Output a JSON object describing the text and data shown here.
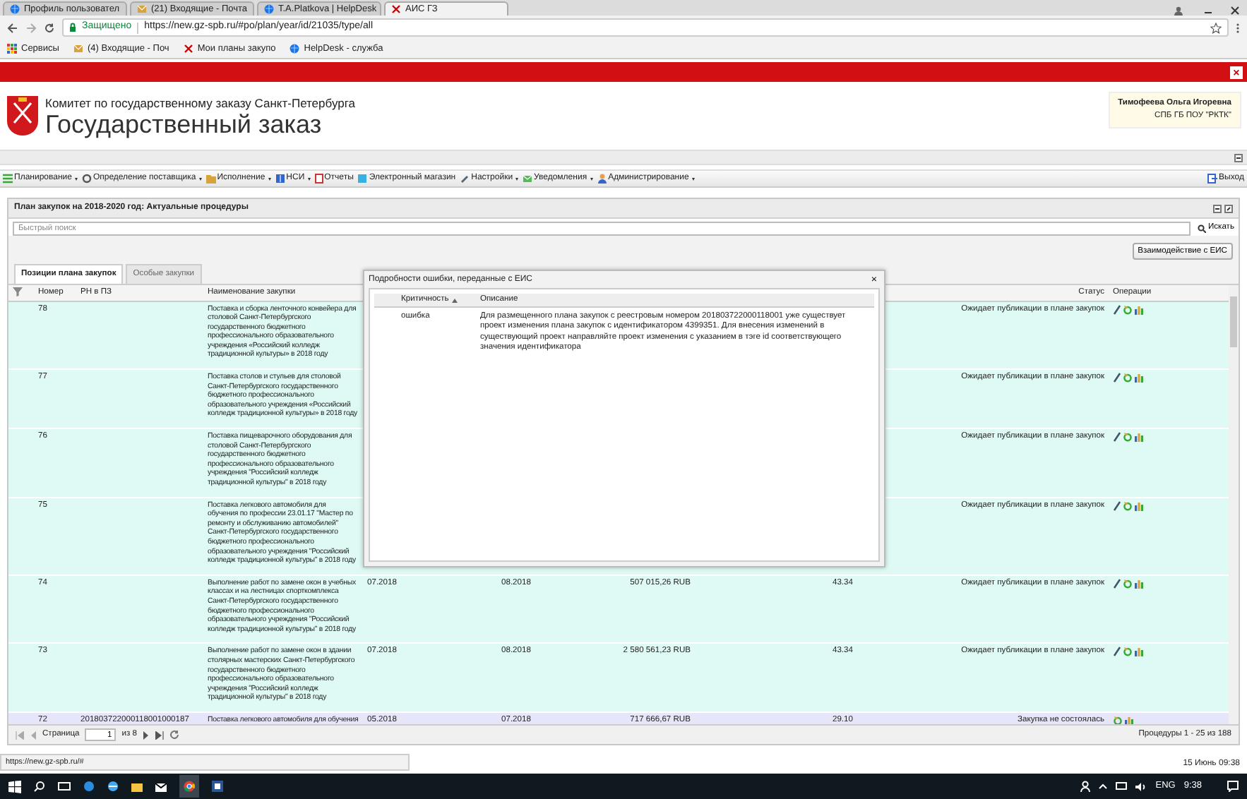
{
  "browser": {
    "tabs": [
      {
        "label": "Профиль пользовател",
        "selected": false
      },
      {
        "label": "(21) Входящие - Почта",
        "selected": false
      },
      {
        "label": "T.A.Platkova | HelpDesk",
        "selected": false
      },
      {
        "label": "АИС ГЗ",
        "selected": true
      }
    ],
    "address": {
      "secure_label": "Защищено",
      "url": "https://new.gz-spb.ru/#po/plan/year/id/21035/type/all"
    },
    "bookmarks": [
      "Сервисы",
      "(4) Входящие - Поч",
      "Мои планы закупо",
      "HelpDesk - служба"
    ]
  },
  "alert_bar": {
    "close": "×"
  },
  "header": {
    "org": "Комитет по государственному заказу Санкт-Петербурга",
    "title": "Государственный заказ",
    "user": {
      "name": "Тимофеева Ольга Игоревна",
      "org": "СПБ ГБ ПОУ \"РКТК\""
    }
  },
  "menu": [
    {
      "label": "Планирование",
      "dropdown": true
    },
    {
      "label": "Определение поставщика",
      "dropdown": true
    },
    {
      "label": "Исполнение",
      "dropdown": true
    },
    {
      "label": "НСИ",
      "dropdown": true
    },
    {
      "label": "Отчеты",
      "dropdown": false
    },
    {
      "label": "Электронный магазин",
      "dropdown": false
    },
    {
      "label": "Настройки",
      "dropdown": true
    },
    {
      "label": "Уведомления",
      "dropdown": true
    },
    {
      "label": "Администрирование",
      "dropdown": true
    }
  ],
  "exit": "Выход",
  "panel": {
    "title": "План закупок на 2018-2020 год: Актуальные процедуры",
    "search": {
      "placeholder": "Быстрый поиск",
      "button": "Искать"
    },
    "eis_button": "Взаимодействие с ЕИС",
    "tabs": [
      {
        "label": "Позиции плана закупок",
        "selected": true
      },
      {
        "label": "Особые закупки",
        "selected": false
      }
    ],
    "table": {
      "columns": [
        "Номер",
        "РН в ПЗ",
        "Наименование закупки",
        "Статус",
        "Операции"
      ],
      "rows": [
        {
          "number": "78",
          "name": "Поставка и сборка ленточного конвейера для столовой Санкт-Петербургского государственного бюджетного профессионального образовательного учреждения «Российский колледж традиционной культуры» в 2018 году",
          "status": "Ожидает публикации в плане закупок",
          "selected": false,
          "actions": [
            {
              "kind": "edit"
            },
            {
              "kind": "refresh"
            },
            {
              "kind": "chart"
            }
          ]
        },
        {
          "number": "77",
          "name": "Поставка столов и стульев для столовой Санкт-Петербургского государственного бюджетного профессионального образовательного учреждения «Российский колледж традиционной культуры» в 2018 году",
          "status": "Ожидает публикации в плане закупок",
          "selected": false,
          "actions": [
            {
              "kind": "edit"
            },
            {
              "kind": "refresh"
            },
            {
              "kind": "chart"
            }
          ]
        },
        {
          "number": "76",
          "name": "Поставка пищеварочного оборудования для столовой Санкт-Петербургского государственного бюджетного профессионального образовательного учреждения \"Российский колледж традиционной культуры\" в 2018 году",
          "status": "Ожидает публикации в плане закупок",
          "selected": false,
          "actions": [
            {
              "kind": "edit"
            },
            {
              "kind": "refresh"
            },
            {
              "kind": "chart"
            }
          ]
        },
        {
          "number": "75",
          "name": "Поставка легкового автомобиля для обучения по профессии 23.01.17 \"Мастер по ремонту и обслуживанию автомобилей\" Санкт-Петербургского государственного бюджетного профессионального образовательного учреждения \"Российский колледж традиционной культуры\" в 2018 году",
          "status": "Ожидает публикации в плане закупок",
          "selected": false,
          "actions": [
            {
              "kind": "edit"
            },
            {
              "kind": "refresh"
            },
            {
              "kind": "chart"
            }
          ]
        },
        {
          "number": "74",
          "name": "Выполнение работ по замене окон в учебных классах и на лестницах спорткомплекса Санкт-Петербургского государственного бюджетного профессионального образовательного учреждения \"Российский колледж традиционной культуры\" в 2018 году",
          "start": "07.2018",
          "end": "08.2018",
          "amount": "507 015,26 RUB",
          "value": "43.34",
          "status": "Ожидает публикации в плане закупок",
          "selected": false,
          "actions": [
            {
              "kind": "edit"
            },
            {
              "kind": "refresh"
            },
            {
              "kind": "chart"
            }
          ]
        },
        {
          "number": "73",
          "name": "Выполнение работ по замене окон в здании столярных мастерских Санкт-Петербургского государственного бюджетного профессионального образовательного учреждения \"Российский колледж традиционной культуры\" в 2018 году",
          "start": "07.2018",
          "end": "08.2018",
          "amount": "2 580 561,23 RUB",
          "value": "43.34",
          "status": "Ожидает публикации в плане закупок",
          "selected": false,
          "actions": [
            {
              "kind": "edit"
            },
            {
              "kind": "refresh"
            },
            {
              "kind": "chart"
            }
          ]
        },
        {
          "number": "72",
          "rn": "201803722000118001000187",
          "name": "Поставка легкового автомобиля для обучения",
          "start": "05.2018",
          "end": "07.2018",
          "amount": "717 666,67 RUB",
          "value": "29.10",
          "status": "Закупка не состоялась",
          "selected": true,
          "actions": [
            {
              "kind": "refresh"
            },
            {
              "kind": "chart"
            }
          ]
        }
      ]
    },
    "pager": {
      "label": "Страница",
      "page": "1",
      "of": "из 8",
      "summary": "Процедуры 1 - 25 из 188"
    }
  },
  "modal": {
    "title": "Подробности ошибки, переданные с ЕИС",
    "close": "×",
    "columns": [
      {
        "label": "Критичность",
        "sorted": true
      },
      {
        "label": "Описание",
        "sorted": false
      }
    ],
    "rows": [
      {
        "severity": "ошибка",
        "description": "Для размещенного плана закупок с реестровым номером 201803722000118001 уже существует проект изменения плана закупок с идентификатором 4399351. Для внесения изменений в существующий проект направляйте проект изменения с указанием в тэге id соответствующего значения идентификатора"
      }
    ]
  },
  "status_bar": {
    "url_hint": "https://new.gz-spb.ru/#",
    "datetime": "15 Июнь 09:38"
  },
  "taskbar": {
    "lang": "ENG",
    "time": "9:38"
  }
}
